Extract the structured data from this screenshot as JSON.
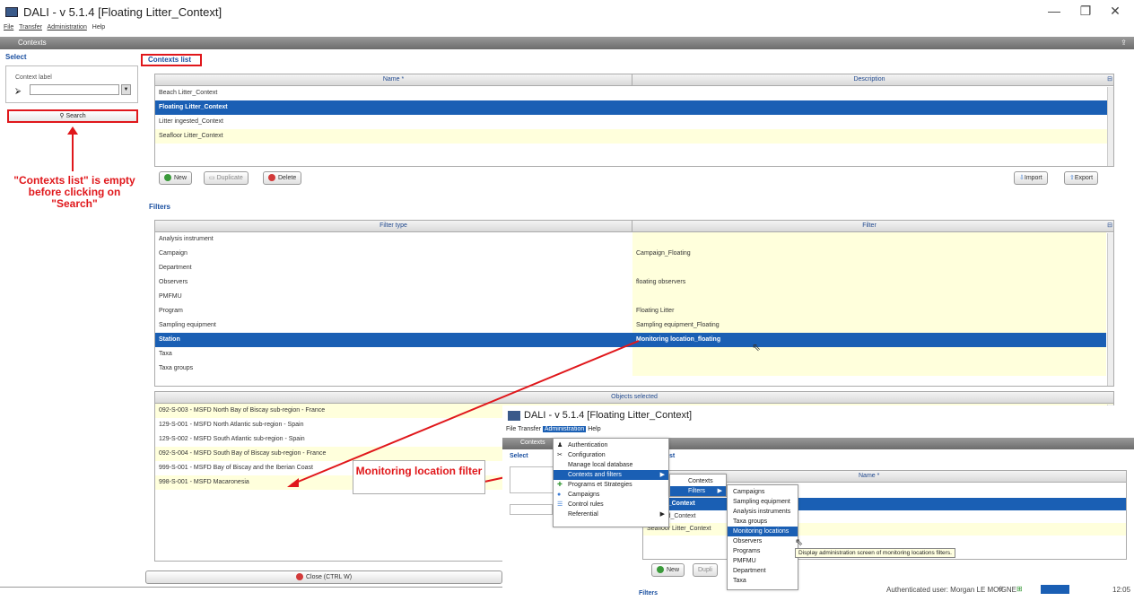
{
  "window": {
    "title": "DALI - v 5.1.4 [Floating Litter_Context]",
    "minimize": "—",
    "restore": "❐",
    "close": "✕"
  },
  "menubar": [
    "File",
    "Transfer",
    "Administration",
    "Help"
  ],
  "header": {
    "label": "Contexts",
    "icon": "⇪"
  },
  "select": {
    "title": "Select",
    "context_label": "Context label",
    "search_label": "Search"
  },
  "contexts_list": {
    "title": "Contexts list",
    "col_name": "Name *",
    "col_description": "Description",
    "rows": [
      "Beach Litter_Context",
      "Floating Litter_Context",
      "Litter ingested_Context",
      "Seafloor Litter_Context"
    ],
    "buttons": {
      "new": "New",
      "duplicate": "Duplicate",
      "delete": "Delete",
      "import": "Import",
      "export": "Export"
    }
  },
  "filters": {
    "title": "Filters",
    "col_type": "Filter type",
    "col_filter": "Filter",
    "rows": [
      {
        "type": "Analysis instrument",
        "filter": ""
      },
      {
        "type": "Campaign",
        "filter": "Campaign_Floating"
      },
      {
        "type": "Department",
        "filter": ""
      },
      {
        "type": "Observers",
        "filter": "floating observers"
      },
      {
        "type": "PMFMU",
        "filter": ""
      },
      {
        "type": "Program",
        "filter": "Floating Litter"
      },
      {
        "type": "Sampling equipment",
        "filter": "Sampling equipment_Floating"
      },
      {
        "type": "Station",
        "filter": "Monitoring location_floating"
      },
      {
        "type": "Taxa",
        "filter": ""
      },
      {
        "type": "Taxa groups",
        "filter": ""
      }
    ]
  },
  "objects": {
    "title": "Objects selected",
    "rows": [
      "092-S-003 - MSFD North Bay of Biscay sub-region - France",
      "129-S-001 - MSFD North Atlantic sub-region - Spain",
      "129-S-002 - MSFD South Atlantic sub-region - Spain",
      "092-S-004 - MSFD South Bay of Biscay sub-region - France",
      "999-S-001 - MSFD Bay of Biscay and the Iberian Coast",
      "998-S-001 - MSFD Macaronesia"
    ]
  },
  "close_button": "Close (CTRL W)",
  "annotations": {
    "contexts_empty": "\"Contexts list\" is empty before clicking on \"Search\"",
    "monitoring": "Monitoring location filter"
  },
  "overlay": {
    "title": "DALI - v 5.1.4 [Floating Litter_Context]",
    "menubar": [
      "File",
      "Transfer",
      "Administration",
      "Help"
    ],
    "contexts": "Contexts",
    "select": "Select",
    "list_tab": "ist",
    "col_name": "Name *",
    "admin_menu": [
      "Authentication",
      "Configuration",
      "Manage local database",
      "Contexts and filters",
      "Programs et Strategies",
      "Campaigns",
      "Control rules",
      "Referential"
    ],
    "sub1": [
      "Contexts",
      "Filters"
    ],
    "sub2": [
      "Campaigns",
      "Sampling equipment",
      "Analysis instruments",
      "Taxa groups",
      "Monitoring locations",
      "Observers",
      "Programs",
      "PMFMU",
      "Department",
      "Taxa"
    ],
    "tooltip": "Display administration screen of monitoring locations filters.",
    "list_rows": [
      "g Litter_Context",
      "ingested_Context",
      "Seafloor Litter_Context"
    ],
    "new": "New",
    "dupl": "Dupli",
    "filters": "Filters"
  },
  "statusbar": {
    "user": "Authenticated user: Morgan LE MOIGNE",
    "time": "12:05"
  }
}
